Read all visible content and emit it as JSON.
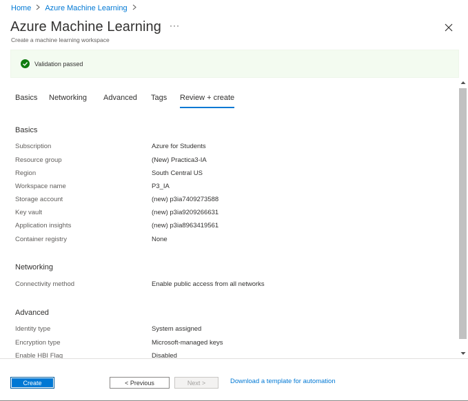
{
  "breadcrumb": [
    "Home",
    "Azure Machine Learning"
  ],
  "header": {
    "title": "Azure Machine Learning",
    "more": "···",
    "subtitle": "Create a machine learning workspace"
  },
  "validation": {
    "text": "Validation passed",
    "status_color": "#107c10"
  },
  "tabs": [
    {
      "label": "Basics",
      "active": false
    },
    {
      "label": "Networking",
      "active": false
    },
    {
      "label": "Advanced",
      "active": false
    },
    {
      "label": "Tags",
      "active": false
    },
    {
      "label": "Review + create",
      "active": true
    }
  ],
  "sections": {
    "basics": {
      "title": "Basics",
      "rows": [
        {
          "label": "Subscription",
          "value": "Azure for Students"
        },
        {
          "label": "Resource group",
          "value": "(New) Practica3-IA"
        },
        {
          "label": "Region",
          "value": "South Central US"
        },
        {
          "label": "Workspace name",
          "value": "P3_IA"
        },
        {
          "label": "Storage account",
          "value": "(new) p3ia7409273588"
        },
        {
          "label": "Key vault",
          "value": "(new) p3ia9209266631"
        },
        {
          "label": "Application insights",
          "value": "(new) p3ia8963419561"
        },
        {
          "label": "Container registry",
          "value": "None"
        }
      ]
    },
    "networking": {
      "title": "Networking",
      "rows": [
        {
          "label": "Connectivity method",
          "value": "Enable public access from all networks"
        }
      ]
    },
    "advanced": {
      "title": "Advanced",
      "rows": [
        {
          "label": "Identity type",
          "value": "System assigned"
        },
        {
          "label": "Encryption type",
          "value": "Microsoft-managed keys"
        },
        {
          "label": "Enable HBI Flag",
          "value": "Disabled"
        }
      ]
    }
  },
  "footer": {
    "create_label": "Create",
    "previous_label": "< Previous",
    "next_label": "Next >",
    "download_link": "Download a template for automation"
  },
  "colors": {
    "accent": "#0078d4",
    "success": "#107c10"
  },
  "icons": [
    "chevron-right-icon",
    "close-icon",
    "check-circle-icon",
    "scroll-up-icon",
    "scroll-down-icon"
  ]
}
